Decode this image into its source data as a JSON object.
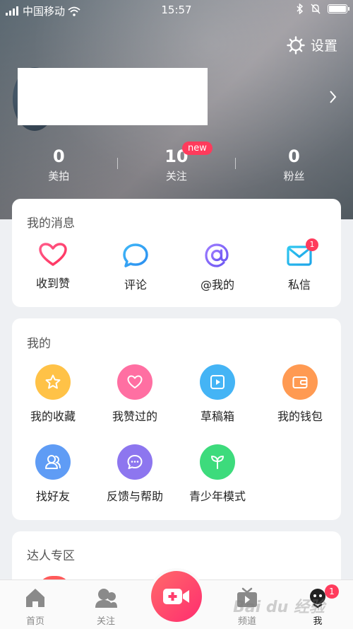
{
  "status_bar": {
    "carrier": "中国移动",
    "time": "15:57"
  },
  "header": {
    "settings_label": "设置"
  },
  "stats": [
    {
      "value": "0",
      "label": "美拍"
    },
    {
      "value": "10",
      "label": "关注",
      "badge": "new"
    },
    {
      "value": "0",
      "label": "粉丝"
    }
  ],
  "messages": {
    "title": "我的消息",
    "items": [
      {
        "label": "收到赞",
        "icon": "heart-icon"
      },
      {
        "label": "评论",
        "icon": "comment-icon"
      },
      {
        "label": "@我的",
        "icon": "at-icon"
      },
      {
        "label": "私信",
        "icon": "mail-icon",
        "badge": "1"
      }
    ]
  },
  "mine": {
    "title": "我的",
    "items": [
      {
        "label": "我的收藏",
        "icon": "star-icon",
        "color": "#ffc247"
      },
      {
        "label": "我赞过的",
        "icon": "heart-icon",
        "color": "#ff6fa2"
      },
      {
        "label": "草稿箱",
        "icon": "play-icon",
        "color": "#44b4f5"
      },
      {
        "label": "我的钱包",
        "icon": "wallet-icon",
        "color": "#ff9a52"
      },
      {
        "label": "找好友",
        "icon": "friends-icon",
        "color": "#5f9cf5"
      },
      {
        "label": "反馈与帮助",
        "icon": "chat-icon",
        "color": "#8d76ef"
      },
      {
        "label": "青少年模式",
        "icon": "sprout-icon",
        "color": "#3ddb7c"
      }
    ]
  },
  "experts": {
    "title": "达人专区"
  },
  "tabbar": {
    "items": [
      {
        "label": "首页",
        "icon": "home-icon"
      },
      {
        "label": "关注",
        "icon": "follow-icon"
      },
      {
        "label": "频道",
        "icon": "tv-icon"
      },
      {
        "label": "我",
        "icon": "me-icon",
        "badge": "1"
      }
    ]
  },
  "watermark": "Bai du 经验"
}
